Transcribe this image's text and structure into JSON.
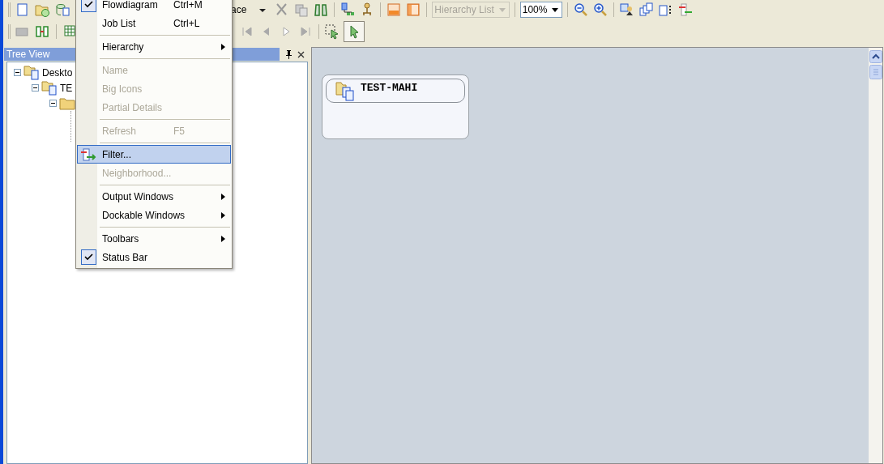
{
  "toolbar": {
    "partial_label": "ace",
    "hierarchy_combo": {
      "value": "Hierarchy List",
      "disabled": true
    },
    "zoom_combo": {
      "value": "100%",
      "disabled": false
    }
  },
  "tree_view": {
    "title": "Tree View",
    "nodes": [
      {
        "label": "Deskto",
        "expanded": true,
        "children": [
          {
            "label": "TE",
            "expanded": true,
            "children": [
              {
                "expanded": true
              }
            ]
          }
        ]
      }
    ]
  },
  "menu": {
    "items": [
      {
        "kind": "item",
        "label": "Flowdiagram",
        "shortcut": "Ctrl+M",
        "checked": true,
        "disabled": false,
        "selected": false,
        "submenu": false,
        "icon": false
      },
      {
        "kind": "item",
        "label": "Job List",
        "shortcut": "Ctrl+L",
        "checked": false,
        "disabled": false,
        "selected": false,
        "submenu": false,
        "icon": false
      },
      {
        "kind": "separator"
      },
      {
        "kind": "item",
        "label": "Hierarchy",
        "checked": false,
        "disabled": false,
        "selected": false,
        "submenu": true,
        "icon": false
      },
      {
        "kind": "separator"
      },
      {
        "kind": "item",
        "label": "Name",
        "checked": false,
        "disabled": true,
        "selected": false,
        "submenu": false,
        "icon": false
      },
      {
        "kind": "item",
        "label": "Big Icons",
        "checked": false,
        "disabled": true,
        "selected": false,
        "submenu": false,
        "icon": false
      },
      {
        "kind": "item",
        "label": "Partial Details",
        "checked": false,
        "disabled": true,
        "selected": false,
        "submenu": false,
        "icon": false
      },
      {
        "kind": "separator"
      },
      {
        "kind": "item",
        "label": "Refresh",
        "shortcut": "F5",
        "checked": false,
        "disabled": true,
        "selected": false,
        "submenu": false,
        "icon": false
      },
      {
        "kind": "separator"
      },
      {
        "kind": "item",
        "label": "Filter...",
        "checked": false,
        "disabled": false,
        "selected": true,
        "submenu": false,
        "icon": true
      },
      {
        "kind": "item",
        "label": "Neighborhood...",
        "checked": false,
        "disabled": true,
        "selected": false,
        "submenu": false,
        "icon": false
      },
      {
        "kind": "separator"
      },
      {
        "kind": "item",
        "label": "Output Windows",
        "checked": false,
        "disabled": false,
        "selected": false,
        "submenu": true,
        "icon": false
      },
      {
        "kind": "item",
        "label": "Dockable Windows",
        "checked": false,
        "disabled": false,
        "selected": false,
        "submenu": true,
        "icon": false
      },
      {
        "kind": "separator"
      },
      {
        "kind": "item",
        "label": "Toolbars",
        "checked": false,
        "disabled": false,
        "selected": false,
        "submenu": true,
        "icon": false
      },
      {
        "kind": "item",
        "label": "Status Bar",
        "checked": true,
        "disabled": false,
        "selected": false,
        "submenu": false,
        "icon": false
      }
    ]
  },
  "canvas": {
    "node": {
      "label": "TEST-MAHI"
    }
  }
}
